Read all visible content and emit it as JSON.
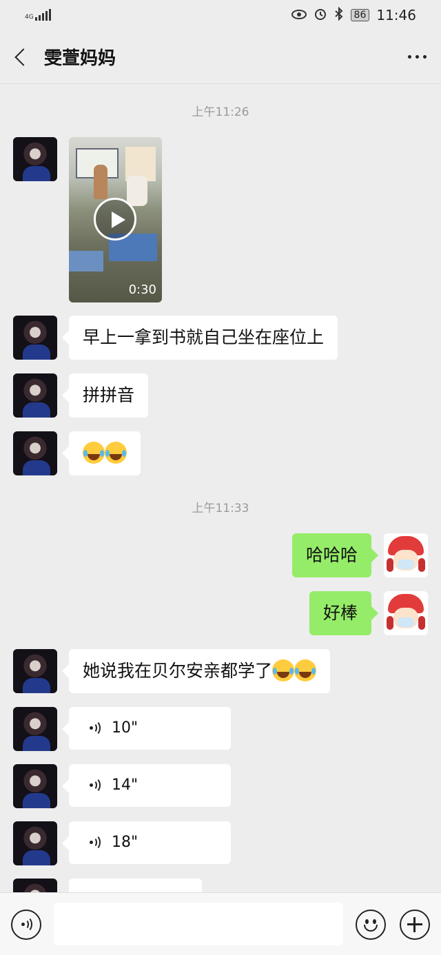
{
  "status_bar": {
    "network": "4G",
    "battery": "86",
    "time": "11:46"
  },
  "nav": {
    "title": "雯萱妈妈",
    "back_icon": "chevron-left-icon",
    "more_icon": "more-icon"
  },
  "chat": {
    "timestamps": [
      "上午11:26",
      "上午11:33"
    ],
    "video": {
      "duration": "0:30"
    },
    "messages": [
      {
        "text": "早上一拿到书就自己坐在座位上"
      },
      {
        "text": "拼拼音"
      },
      {
        "text": ""
      },
      {
        "text": "哈哈哈"
      },
      {
        "text": "好棒"
      },
      {
        "text": "她说我在贝尔安亲都学了"
      }
    ],
    "voice_messages": [
      {
        "duration": "10\""
      },
      {
        "duration": "14\""
      },
      {
        "duration": "18\""
      }
    ]
  },
  "colors": {
    "background": "#ededed",
    "incoming_bubble": "#ffffff",
    "outgoing_bubble": "#95ec69"
  }
}
